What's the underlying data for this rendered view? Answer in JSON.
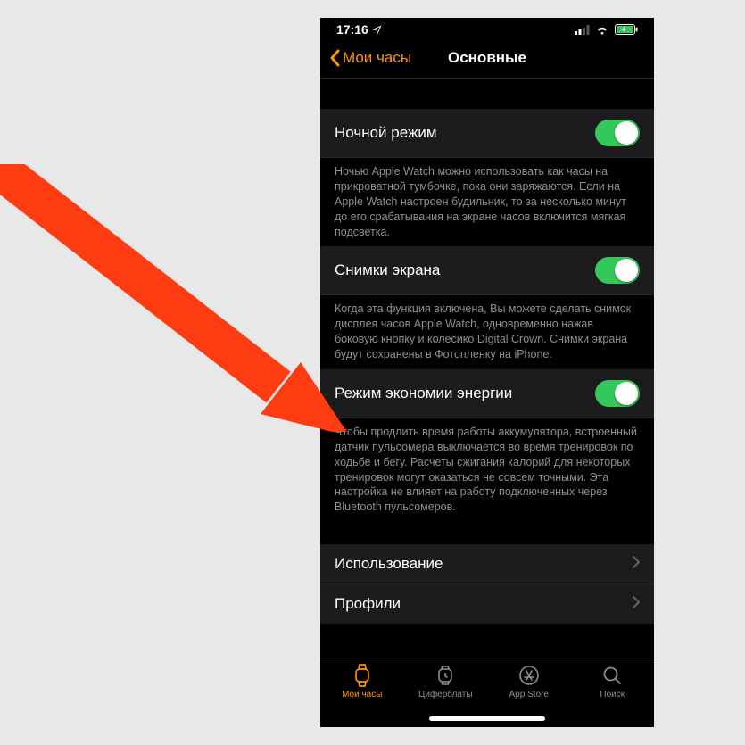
{
  "statusBar": {
    "time": "17:16"
  },
  "nav": {
    "back": "Мои часы",
    "title": "Основные"
  },
  "sections": {
    "nightMode": {
      "label": "Ночной режим",
      "desc": "Ночью Apple Watch можно использовать как часы на прикроватной тумбочке, пока они заряжаются. Если на Apple Watch настроен будильник, то за несколько минут до его срабатывания на экране часов включится мягкая подсветка."
    },
    "screenshots": {
      "label": "Снимки экрана",
      "desc": "Когда эта функция включена, Вы можете сделать снимок дисплея часов Apple Watch, одновременно нажав боковую кнопку и колесико Digital Crown. Снимки экрана будут сохранены в Фотопленку на iPhone."
    },
    "powerSaving": {
      "label": "Режим экономии энергии",
      "desc": "Чтобы продлить время работы аккумулятора, встроенный датчик пульсомера выключается во время тренировок по ходьбе и бегу. Расчеты сжигания калорий для некоторых тренировок могут оказаться не совсем точными. Эта настройка не влияет на работу подключенных через Bluetooth пульсомеров."
    },
    "usage": {
      "label": "Использование"
    },
    "profiles": {
      "label": "Профили"
    }
  },
  "tabs": {
    "watch": "Мои часы",
    "faces": "Циферблаты",
    "appstore": "App Store",
    "search": "Поиск"
  },
  "colors": {
    "accent": "#ff9500",
    "toggleOn": "#34c759",
    "arrow": "#ff3b12"
  }
}
